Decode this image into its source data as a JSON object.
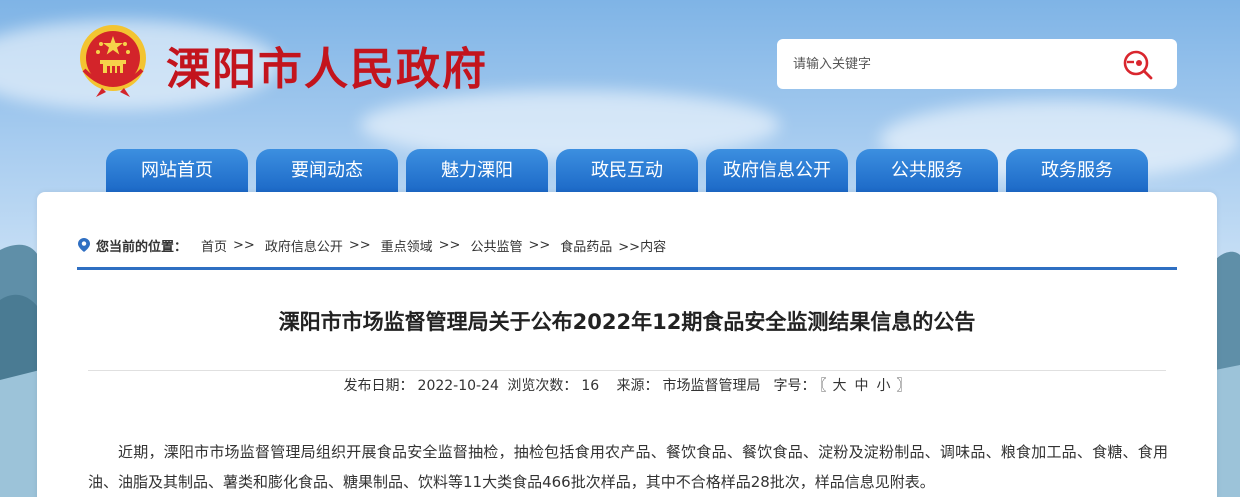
{
  "header": {
    "site_title": "溧阳市人民政府",
    "emblem_icon": "national-emblem-icon"
  },
  "search": {
    "placeholder": "请输入关键字",
    "icon": "search-icon"
  },
  "nav": {
    "items": [
      {
        "label": "网站首页"
      },
      {
        "label": "要闻动态"
      },
      {
        "label": "魅力溧阳"
      },
      {
        "label": "政民互动"
      },
      {
        "label": "政府信息公开"
      },
      {
        "label": "公共服务"
      },
      {
        "label": "政务服务"
      }
    ]
  },
  "breadcrumb": {
    "label": "您当前的位置：",
    "links": [
      "首页",
      "政府信息公开",
      "重点领域",
      "公共监管",
      "食品药品"
    ],
    "separator": ">>",
    "current": ">>内容"
  },
  "article": {
    "title": "溧阳市市场监督管理局关于公布2022年12期食品安全监测结果信息的公告",
    "meta": {
      "date_label": "发布日期：",
      "date": "2022-10-24",
      "views_label": "浏览次数：",
      "views": "16",
      "source_label": "来源：",
      "source": "市场监督管理局",
      "fontsize_label": "字号：",
      "fontsize_open": "〖",
      "fontsize_large": "大",
      "fontsize_medium": "中",
      "fontsize_small": "小",
      "fontsize_close": "〗"
    },
    "body": "近期，溧阳市市场监督管理局组织开展食品安全监督抽检，抽检包括食用农产品、餐饮食品、餐饮食品、淀粉及淀粉制品、调味品、粮食加工品、食糖、食用油、油脂及其制品、薯类和膨化食品、糖果制品、饮料等11大类食品466批次样品，其中不合格样品28批次，样品信息见附表。"
  },
  "colors": {
    "brand_red": "#c3141d",
    "nav_blue": "#1c69c7",
    "rule_blue": "#2f6fc2"
  }
}
